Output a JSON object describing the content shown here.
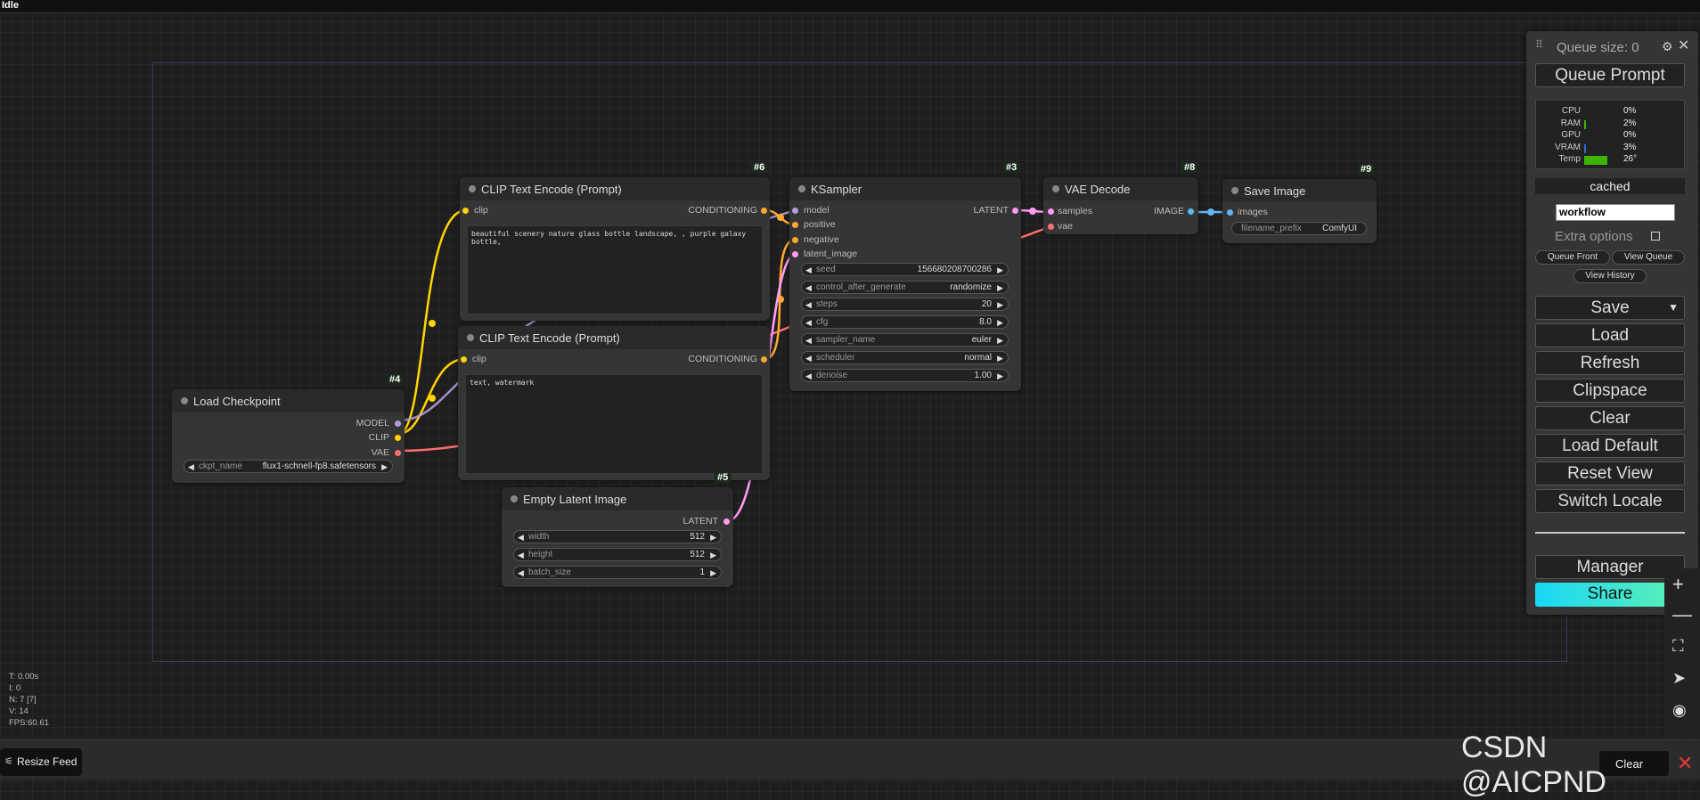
{
  "status": "Idle",
  "colors": {
    "clip": "#ffd500",
    "model": "#b39ddb",
    "vae": "#ff6e6e",
    "latent": "#ff9cf9",
    "conditioning": "#ffa931",
    "image": "#64b5f6",
    "share_start": "#19d7f5",
    "share_end": "#5ef2b4",
    "temp_bar": "#3cb500",
    "vram_bar": "#2a6ad8"
  },
  "nodes": {
    "clip_pos": {
      "badge": "#6",
      "title": "CLIP Text Encode (Prompt)",
      "in": "clip",
      "out": "CONDITIONING",
      "text": "beautiful scenery nature glass bottle landscape, , purple galaxy bottle,"
    },
    "clip_neg": {
      "title": "CLIP Text Encode (Prompt)",
      "in": "clip",
      "out": "CONDITIONING",
      "text": "text, watermark"
    },
    "ksampler": {
      "badge": "#3",
      "title": "KSampler",
      "inputs": [
        "model",
        "positive",
        "negative",
        "latent_image"
      ],
      "out": "LATENT",
      "widgets": [
        {
          "name": "seed",
          "value": "156680208700286"
        },
        {
          "name": "control_after_generate",
          "value": "randomize"
        },
        {
          "name": "steps",
          "value": "20"
        },
        {
          "name": "cfg",
          "value": "8.0"
        },
        {
          "name": "sampler_name",
          "value": "euler"
        },
        {
          "name": "scheduler",
          "value": "normal"
        },
        {
          "name": "denoise",
          "value": "1.00"
        }
      ]
    },
    "vae_decode": {
      "badge": "#8",
      "title": "VAE Decode",
      "inputs": [
        "samples",
        "vae"
      ],
      "out": "IMAGE"
    },
    "save_image": {
      "badge": "#9",
      "title": "Save Image",
      "in": "images",
      "widget": {
        "name": "filename_prefix",
        "value": "ComfyUI"
      }
    },
    "load_ckpt": {
      "badge": "#4",
      "title": "Load Checkpoint",
      "outs": [
        "MODEL",
        "CLIP",
        "VAE"
      ],
      "widget": {
        "name": "ckpt_name",
        "value": "flux1-schnell-fp8.safetensors"
      }
    },
    "empty_latent": {
      "badge": "#5",
      "title": "Empty Latent Image",
      "out": "LATENT",
      "widgets": [
        {
          "name": "width",
          "value": "512"
        },
        {
          "name": "height",
          "value": "512"
        },
        {
          "name": "batch_size",
          "value": "1"
        }
      ]
    }
  },
  "panel": {
    "queue_size": "Queue size: 0",
    "queue_prompt": "Queue Prompt",
    "stats": [
      {
        "label": "CPU",
        "value": "0%",
        "level": 0
      },
      {
        "label": "RAM",
        "value": "2%",
        "level": 2
      },
      {
        "label": "GPU",
        "value": "0%",
        "level": 0
      },
      {
        "label": "VRAM",
        "value": "3%",
        "level": 3
      },
      {
        "label": "Temp",
        "value": "26°",
        "level": 26
      }
    ],
    "cached": "cached",
    "workflow": "workflow",
    "extra_options": "Extra options",
    "queue_front": "Queue Front",
    "view_queue": "View Queue",
    "view_history": "View History",
    "buttons": [
      "Save",
      "Load",
      "Refresh",
      "Clipspace",
      "Clear",
      "Load Default",
      "Reset View",
      "Switch Locale"
    ],
    "manager": "Manager",
    "share": "Share"
  },
  "stats_overlay": [
    "T: 0.00s",
    "I: 0",
    "N: 7 [7]",
    "V: 14",
    "FPS:60.61"
  ],
  "resize_feed": "Resize Feed",
  "clear_bottom": "Clear",
  "watermark": "CSDN @AICPND"
}
